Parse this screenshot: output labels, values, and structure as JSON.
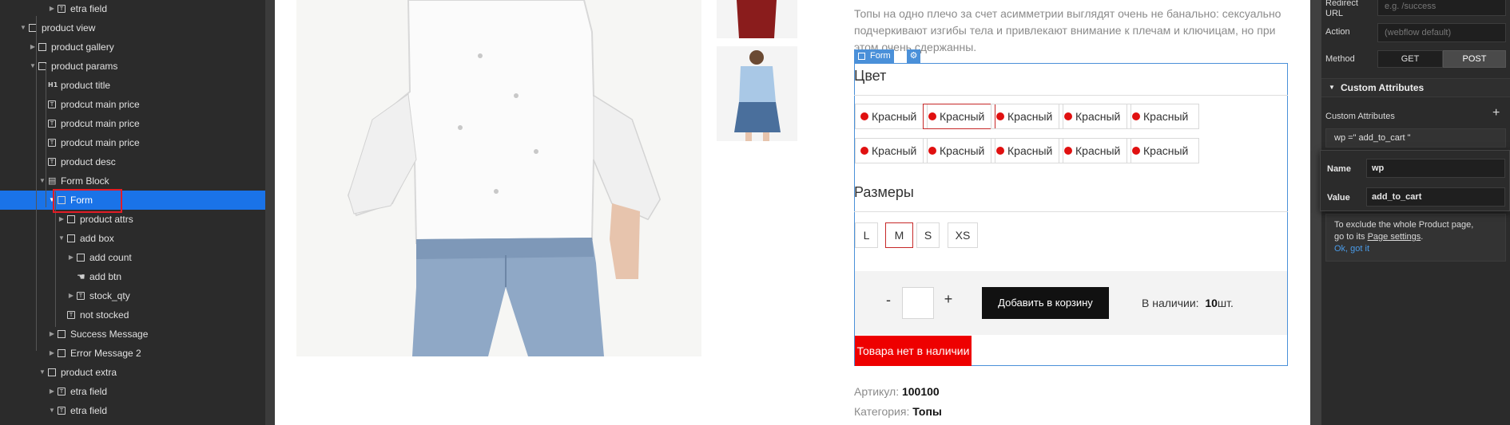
{
  "navigator": {
    "items": [
      {
        "label": "etra field",
        "icon": "text-icon"
      },
      {
        "label": "product view",
        "icon": "box-icon"
      },
      {
        "label": "product gallery",
        "icon": "box-icon"
      },
      {
        "label": "product params",
        "icon": "box-icon"
      },
      {
        "label": "product title",
        "icon": "heading-icon",
        "icon_text": "H1"
      },
      {
        "label": "prodcut main price",
        "icon": "text-icon"
      },
      {
        "label": "prodcut main price",
        "icon": "text-icon"
      },
      {
        "label": "prodcut main price",
        "icon": "text-icon"
      },
      {
        "label": "product desc",
        "icon": "text-icon"
      },
      {
        "label": "Form Block",
        "icon": "form-block-icon"
      },
      {
        "label": "Form",
        "icon": "box-icon"
      },
      {
        "label": "product attrs",
        "icon": "box-icon"
      },
      {
        "label": "add box",
        "icon": "box-icon"
      },
      {
        "label": "add count",
        "icon": "box-icon"
      },
      {
        "label": "add btn",
        "icon": "hand-icon"
      },
      {
        "label": "stock_qty",
        "icon": "text-icon"
      },
      {
        "label": "not stocked",
        "icon": "text-icon"
      },
      {
        "label": "Success Message",
        "icon": "box-icon"
      },
      {
        "label": "Error Message 2",
        "icon": "box-icon"
      },
      {
        "label": "product extra",
        "icon": "box-icon"
      },
      {
        "label": "etra field",
        "icon": "text-icon"
      },
      {
        "label": "etra field",
        "icon": "text-icon"
      }
    ],
    "selected_label": "Form"
  },
  "canvas": {
    "description": "Топы на одно плечо за счет асимметрии выглядят очень не банально: сексуально подчеркивают изгибы тела и привлекают внимание к плечам и ключицам, но при этом очень сдержанны.",
    "form_tag": "Form",
    "color_title": "Цвет",
    "colors": [
      "Красный",
      "Красный",
      "Красный",
      "Красный",
      "Красный",
      "Красный",
      "Красный",
      "Красный",
      "Красный",
      "Красный"
    ],
    "selected_color_index": 1,
    "dot_color": "#e01010",
    "sizes_title": "Размеры",
    "sizes": [
      "L",
      "M",
      "S",
      "XS"
    ],
    "selected_size": "M",
    "qty_minus": "-",
    "qty_plus": "+",
    "add_to_cart": "Добавить в корзину",
    "stock_label": "В наличии:",
    "stock_qty": "10",
    "stock_unit": "шт.",
    "out_of_stock": "Товара нет в наличии",
    "sku_label": "Артикул:",
    "sku_value": "100100",
    "category_label": "Категория:",
    "category_value": "Топы",
    "accent_color": "#4a90d9",
    "out_of_stock_color": "#ee0000"
  },
  "settings": {
    "redirect_label": "Redirect URL",
    "redirect_placeholder": "e.g. /success",
    "action_label": "Action",
    "action_placeholder": "(webflow default)",
    "method_label": "Method",
    "method_get": "GET",
    "method_post": "POST",
    "custom_attributes_header": "Custom Attributes",
    "custom_attributes_label": "Custom Attributes",
    "add_icon": "+",
    "attribute_entry": "wp =\" add_to_cart \"",
    "popup": {
      "name_label": "Name",
      "name_value": "wp",
      "value_label": "Value",
      "value_value": "add_to_cart"
    },
    "note_line1": "To exclude the whole Product page,",
    "note_line2_prefix": "go to its ",
    "note_link": "Page settings",
    "note_line2_suffix": ".",
    "note_ok": "Ok, got it"
  }
}
